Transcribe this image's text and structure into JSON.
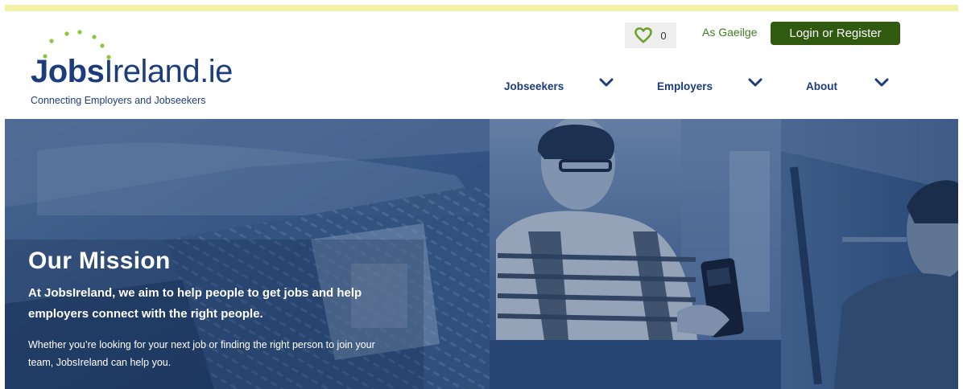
{
  "brand": {
    "name_bold": "Jobs",
    "name_light": "Ireland.ie",
    "tagline": "Connecting Employers and Jobseekers",
    "colors": {
      "navy": "#1c3d7a",
      "green": "#2f5a10",
      "accent_green": "#8cc63f",
      "highlight": "#f3f1a6"
    }
  },
  "header": {
    "favourites": {
      "icon": "heart-icon",
      "count": "0"
    },
    "language_link": "As Gaeilge",
    "login_label": "Login or Register"
  },
  "nav": {
    "items": [
      {
        "label": "Jobseekers",
        "icon": "chevron-down-icon"
      },
      {
        "label": "Employers",
        "icon": "chevron-down-icon"
      },
      {
        "label": "About",
        "icon": "chevron-down-icon"
      }
    ]
  },
  "hero": {
    "title": "Our Mission",
    "lead": "At JobsIreland, we aim to help people to get jobs and help employers connect with the right people.",
    "body": "Whether you’re looking for your next job or finding the right person to join your team, JobsIreland can help you."
  }
}
